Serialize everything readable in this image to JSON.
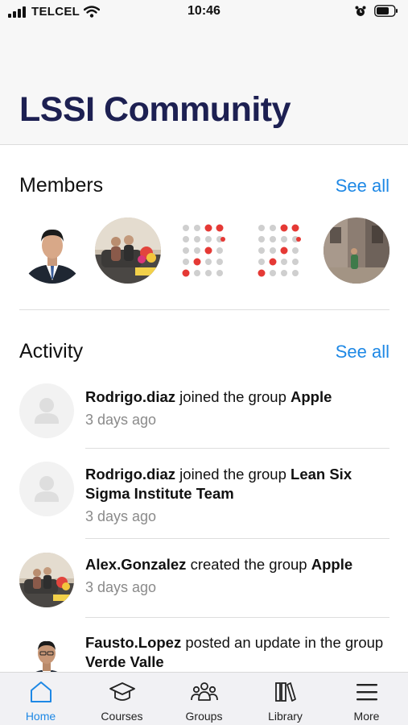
{
  "status_bar": {
    "carrier": "TELCEL",
    "time": "10:46"
  },
  "header": {
    "title": "LSSI Community"
  },
  "members": {
    "title": "Members",
    "see_all": "See all",
    "avatars": [
      "member-photo-man-suit",
      "member-photo-couple",
      "member-logo-dots",
      "member-logo-dots",
      "member-photo-street"
    ]
  },
  "activity": {
    "title": "Activity",
    "see_all": "See all",
    "items": [
      {
        "user": "Rodrigo.diaz",
        "action": "joined the group",
        "target": "Apple",
        "time": "3 days ago",
        "avatar": "placeholder"
      },
      {
        "user": "Rodrigo.diaz",
        "action": "joined the group",
        "target": "Lean Six Sigma Institute Team",
        "time": "3 days ago",
        "avatar": "placeholder"
      },
      {
        "user": "Alex.Gonzalez",
        "action": "created the group",
        "target": "Apple",
        "time": "3 days ago",
        "avatar": "couple-photo"
      },
      {
        "user": "Fausto.Lopez",
        "action": "posted an update in the group",
        "target": "Verde Valle",
        "time": "",
        "avatar": "man-photo"
      }
    ]
  },
  "tabs": [
    {
      "label": "Home",
      "icon": "home-icon",
      "active": true
    },
    {
      "label": "Courses",
      "icon": "graduation-cap-icon",
      "active": false
    },
    {
      "label": "Groups",
      "icon": "groups-icon",
      "active": false
    },
    {
      "label": "Library",
      "icon": "library-icon",
      "active": false
    },
    {
      "label": "More",
      "icon": "menu-icon",
      "active": false
    }
  ],
  "colors": {
    "accent": "#1e88e5",
    "title": "#1d2052",
    "muted": "#8a8a8a",
    "logo_red": "#e53935",
    "logo_grey": "#cfcfcf"
  }
}
